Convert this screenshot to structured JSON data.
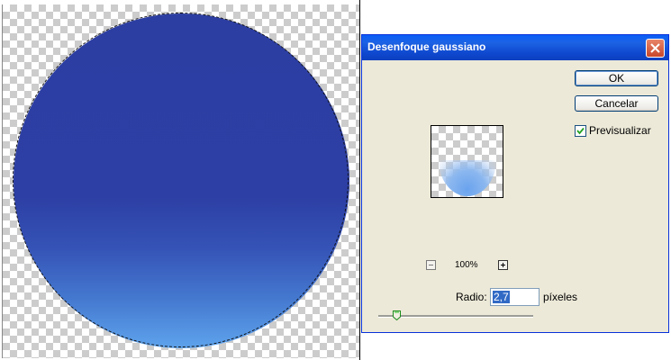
{
  "dialog": {
    "title": "Desenfoque gaussiano",
    "ok_label": "OK",
    "cancel_label": "Cancelar",
    "preview_label": "Previsualizar",
    "preview_checked": true,
    "zoom_level": "100%",
    "radius_label": "Radio:",
    "radius_value": "2,7",
    "radius_unit": "píxeles",
    "slider_position": 0.12
  },
  "colors": {
    "title_bar": "#0a5ef7",
    "dialog_bg": "#ece9d8",
    "sphere_top": "#2c3ea2",
    "sphere_bottom": "#5ea3ec",
    "selection_highlight": "#316ac5"
  },
  "icons": {
    "close": "close-icon",
    "zoom_out": "minus-icon",
    "zoom_in": "plus-icon",
    "check": "checkmark-icon"
  }
}
